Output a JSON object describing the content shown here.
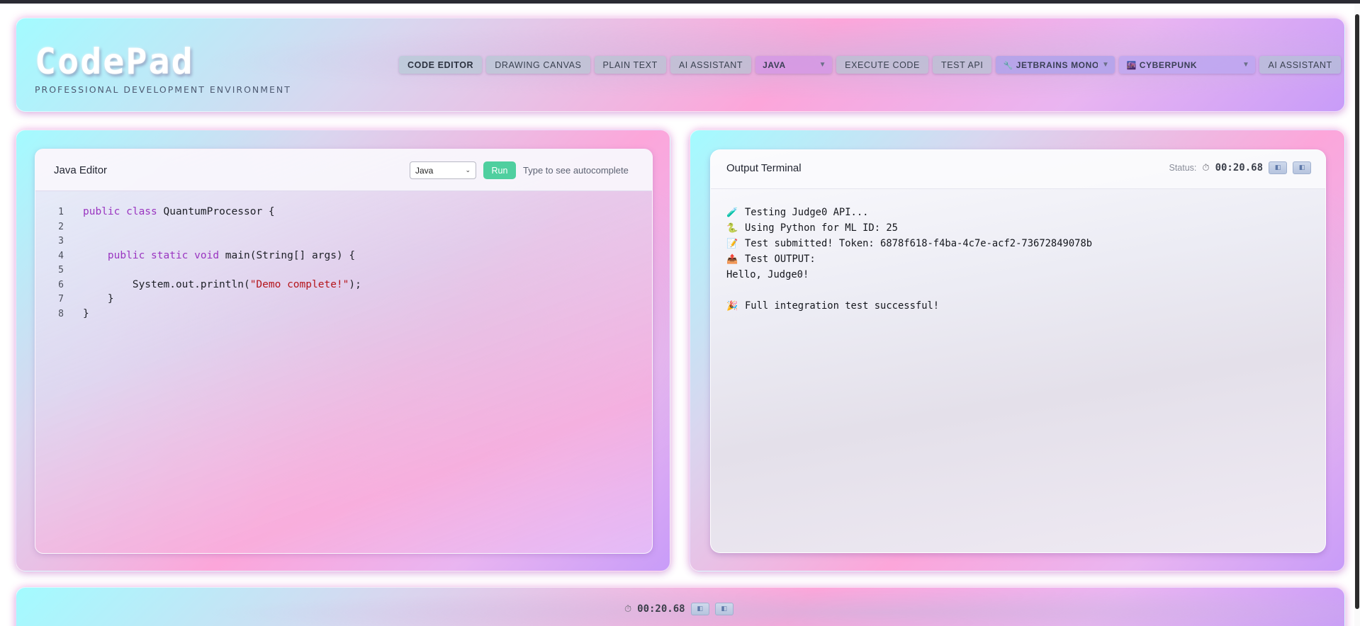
{
  "app": {
    "logo": "CodePad",
    "tagline": "PROFESSIONAL DEVELOPMENT ENVIRONMENT"
  },
  "nav": {
    "code_editor": "CODE EDITOR",
    "drawing_canvas": "DRAWING CANVAS",
    "plain_text": "PLAIN TEXT",
    "ai_assistant": "AI ASSISTANT",
    "language_select": "JAVA",
    "execute_code": "EXECUTE CODE",
    "test_api": "TEST API",
    "font_select": "JETBRAINS MONO",
    "font_icon": "🔧",
    "theme_select": "CYBERPUNK",
    "theme_icon": "🌆",
    "ai_assistant_2": "AI ASSISTANT"
  },
  "editor": {
    "title": "Java Editor",
    "language": "Java",
    "run_label": "Run",
    "hint": "Type to see autocomplete",
    "lines": [
      {
        "n": "1",
        "parts": [
          {
            "t": "public class",
            "c": "kw"
          },
          {
            "t": " QuantumProcessor {",
            "c": ""
          }
        ]
      },
      {
        "n": "2",
        "parts": []
      },
      {
        "n": "3",
        "parts": []
      },
      {
        "n": "4",
        "parts": [
          {
            "t": "    ",
            "c": ""
          },
          {
            "t": "public static void",
            "c": "kw"
          },
          {
            "t": " main(String[] args) {",
            "c": ""
          }
        ]
      },
      {
        "n": "5",
        "parts": []
      },
      {
        "n": "6",
        "parts": [
          {
            "t": "        System.out.println(",
            "c": ""
          },
          {
            "t": "\"Demo complete!\"",
            "c": "str"
          },
          {
            "t": ");",
            "c": ""
          }
        ]
      },
      {
        "n": "7",
        "parts": [
          {
            "t": "    }",
            "c": ""
          }
        ]
      },
      {
        "n": "8",
        "parts": [
          {
            "t": "}",
            "c": ""
          }
        ]
      }
    ]
  },
  "output": {
    "title": "Output Terminal",
    "status_label": "Status:",
    "timer": "00:20.68",
    "lines": [
      {
        "icon": "🧪",
        "text": "Testing Judge0 API..."
      },
      {
        "icon": "🐍",
        "text": "Using Python for ML ID: 25"
      },
      {
        "icon": "📝",
        "text": "Test submitted! Token: 6878f618-f4ba-4c7e-acf2-73672849078b"
      },
      {
        "icon": "📤",
        "text": "Test OUTPUT:"
      },
      {
        "icon": "",
        "text": "Hello, Judge0!"
      },
      {
        "icon": "",
        "text": ""
      },
      {
        "icon": "🎉",
        "text": "Full integration test successful!"
      }
    ]
  },
  "footer": {
    "timer": "00:20.68"
  },
  "icons": {
    "timer": "⏱",
    "mini_button": "◧"
  }
}
